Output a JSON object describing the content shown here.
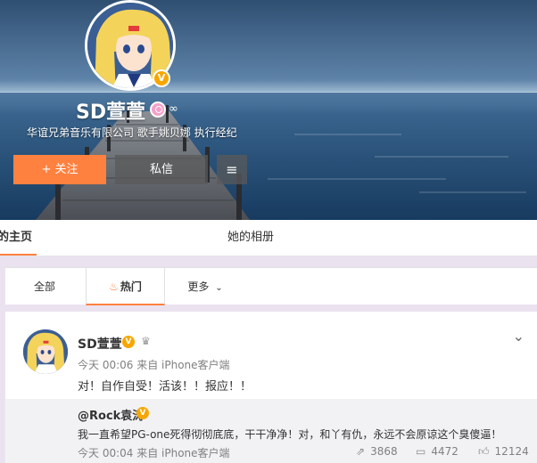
{
  "profile": {
    "name": "SD萱萱",
    "verified_badge": "V",
    "description": "华谊兄弟音乐有限公司 歌手姚贝娜 执行经纪",
    "follow_button": "+ 关注",
    "message_button": "私信",
    "menu_icon": "menu-icon"
  },
  "tabs": {
    "home": "的主页",
    "album": "她的相册"
  },
  "filter": {
    "all": "全部",
    "hot": "热门",
    "more": "更多"
  },
  "post": {
    "author": "SD萱萱",
    "verified_badge": "V",
    "time": "今天 00:06 来自 iPhone客户端",
    "text": "对！自作自受！活该！！报应！！",
    "repost": {
      "user": "@Rock袁涛",
      "verified_badge": "V",
      "text": "我一直希望PG-one死得彻彻底底，干干净净！对，和丫有仇，永远不会原谅这个臭傻逼！",
      "time": "今天 00:04 来自 iPhone客户端",
      "shares": "3868",
      "comments": "4472",
      "likes": "12124"
    }
  },
  "colors": {
    "accent": "#ff8140",
    "verified": "#f7a600",
    "page_bg": "#ebe2f0"
  }
}
